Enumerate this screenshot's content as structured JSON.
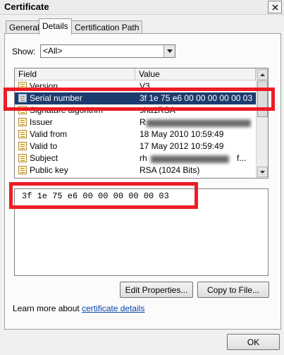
{
  "window": {
    "title": "Certificate"
  },
  "tabs": [
    {
      "label": "General"
    },
    {
      "label": "Details"
    },
    {
      "label": "Certification Path"
    }
  ],
  "show": {
    "label": "Show:",
    "value": "<All>"
  },
  "list": {
    "columns": [
      "Field",
      "Value"
    ],
    "rows": [
      {
        "field": "Version",
        "value": "V3"
      },
      {
        "field": "Serial number",
        "value": "3f 1e 75 e6 00 00 00 00 00 03",
        "selected": true
      },
      {
        "field": "Signature algorithm",
        "value": "sha1RSA"
      },
      {
        "field": "Issuer",
        "value": "R"
      },
      {
        "field": "Valid from",
        "value": "18 May 2010 10:59:49"
      },
      {
        "field": "Valid to",
        "value": "17 May 2012 10:59:49"
      },
      {
        "field": "Subject",
        "value": "rh",
        "value_tail": "f..."
      },
      {
        "field": "Public key",
        "value": "RSA (1024 Bits)"
      }
    ]
  },
  "detail": {
    "value": "3f 1e 75 e6 00 00 00 00 00 03"
  },
  "buttons": {
    "edit_properties": "Edit Properties...",
    "copy_to_file": "Copy to File...",
    "ok": "OK"
  },
  "learn_more": {
    "prefix": "Learn more about ",
    "link": "certificate details"
  },
  "colors": {
    "selection": "#1d3c6e",
    "highlight": "#ee1c25",
    "link": "#0645ad"
  }
}
